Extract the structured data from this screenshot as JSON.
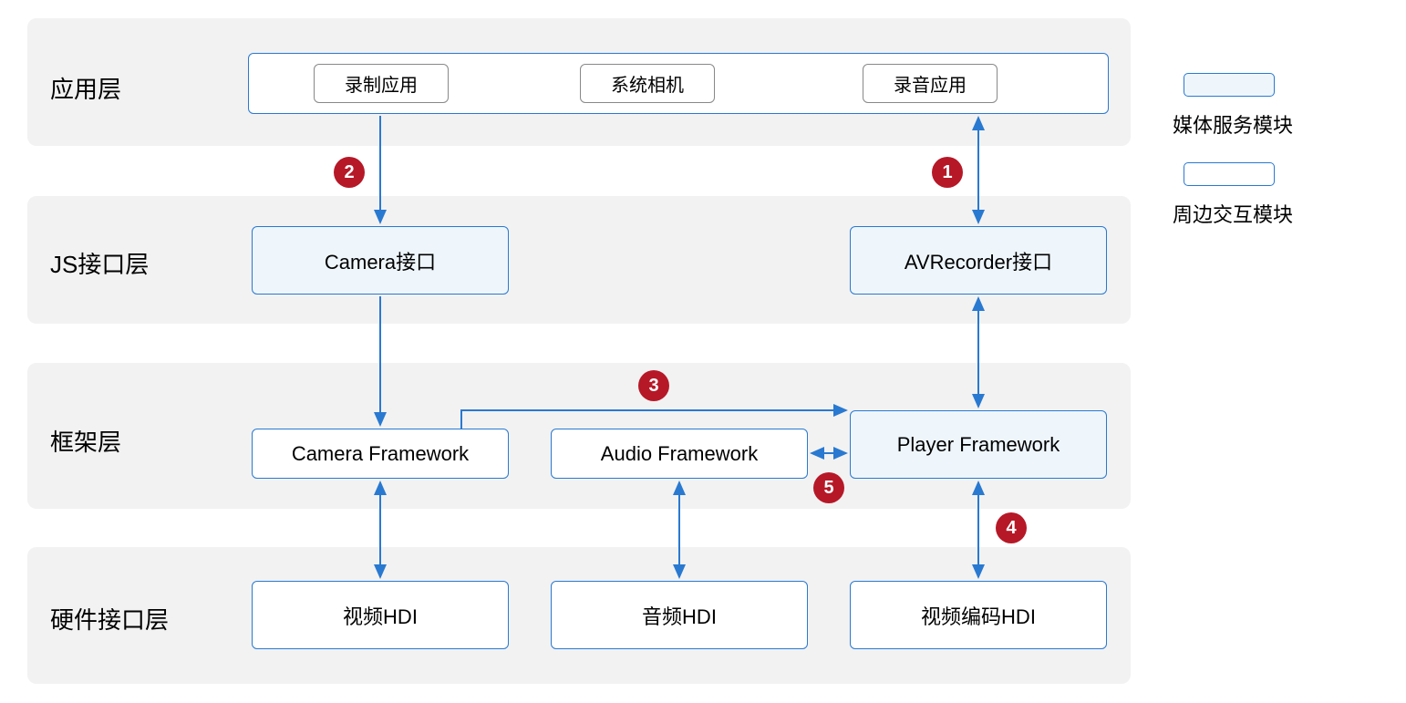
{
  "layers": {
    "app": "应用层",
    "js": "JS接口层",
    "framework": "框架层",
    "hw": "硬件接口层"
  },
  "app_container_boxes": {
    "record_app": "录制应用",
    "sys_camera": "系统相机",
    "audio_app": "录音应用"
  },
  "js_boxes": {
    "camera_if": "Camera接口",
    "avrecorder_if": "AVRecorder接口"
  },
  "fw_boxes": {
    "camera_fw": "Camera Framework",
    "audio_fw": "Audio Framework",
    "player_fw": "Player Framework"
  },
  "hw_boxes": {
    "video_hdi": "视频HDI",
    "audio_hdi": "音频HDI",
    "video_enc_hdi": "视频编码HDI"
  },
  "badges": {
    "b1": "1",
    "b2": "2",
    "b3": "3",
    "b4": "4",
    "b5": "5"
  },
  "legend": {
    "media_module": "媒体服务模块",
    "peripheral_module": "周边交互模块"
  },
  "colors": {
    "layer_bg": "#f2f2f2",
    "blue": "#2979d1",
    "blue_fill": "#eef6fc",
    "badge": "#b61827",
    "gray_border": "#888"
  }
}
